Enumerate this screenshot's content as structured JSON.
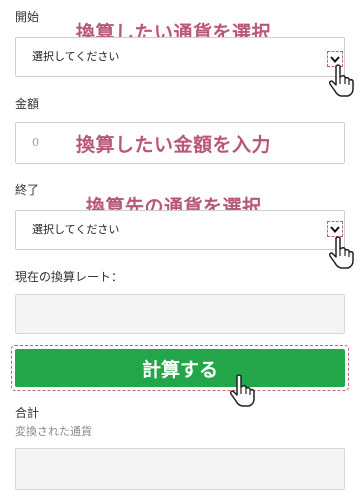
{
  "start": {
    "label": "開始",
    "select_value": "選択してください",
    "annotation": "換算したい通貨を選択"
  },
  "amount": {
    "label": "金額",
    "value": "0",
    "annotation": "換算したい金額を入力"
  },
  "end": {
    "label": "終了",
    "select_value": "選択してください",
    "annotation": "換算先の通貨を選択"
  },
  "rate": {
    "label": "現在の換算レート："
  },
  "calculate": {
    "label": "計算する"
  },
  "total": {
    "label": "合計",
    "sublabel": "変換された通貨"
  },
  "colors": {
    "annotation": "#b8577a",
    "button": "#23a64a",
    "dashed_outline": "#c0607a"
  },
  "icons": [
    "chevron-down-icon",
    "pointer-hand-icon"
  ]
}
